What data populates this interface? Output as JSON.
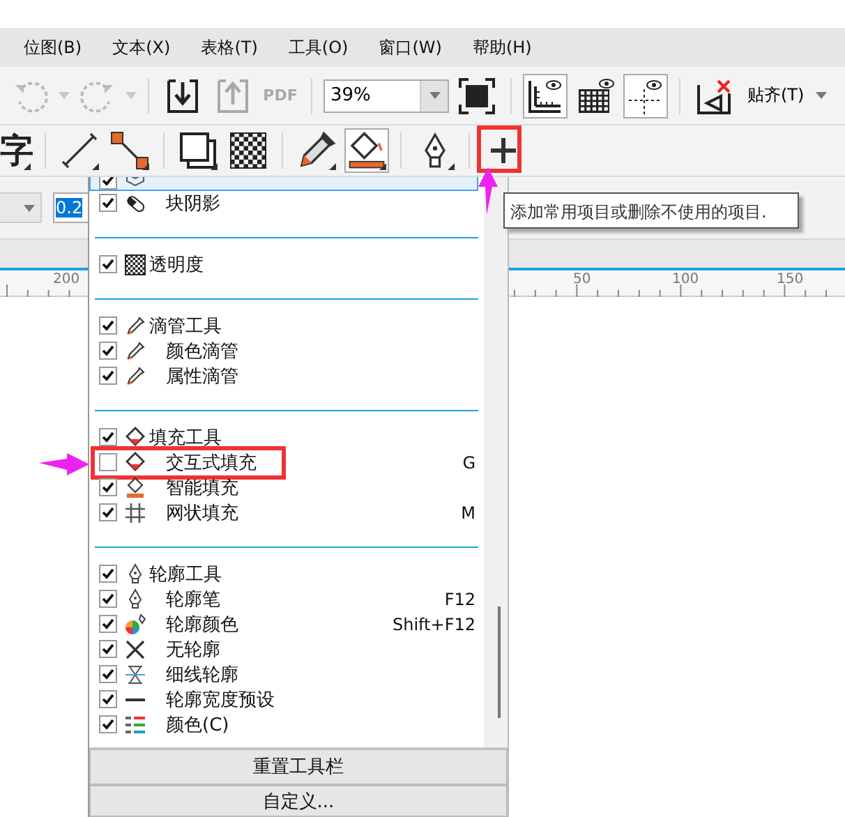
{
  "menu_bar": [
    {
      "label": "位图(B)"
    },
    {
      "label": "文本(X)"
    },
    {
      "label": "表格(T)"
    },
    {
      "label": "工具(O)"
    },
    {
      "label": "窗口(W)"
    },
    {
      "label": "帮助(H)"
    }
  ],
  "standard_toolbar": [
    {
      "kind": "button",
      "disabled": true,
      "dropdown": true
    },
    {
      "kind": "button",
      "disabled": true,
      "dropdown": true
    },
    {
      "kind": "separator"
    },
    {
      "kind": "button",
      "disabled": false
    },
    {
      "kind": "button",
      "disabled": true
    },
    {
      "kind": "button",
      "disabled": true,
      "label": "PDF"
    },
    {
      "kind": "separator"
    },
    {
      "kind": "combo",
      "value": "39%"
    },
    {
      "kind": "button",
      "disabled": false
    },
    {
      "kind": "separator"
    },
    {
      "kind": "button",
      "disabled": false,
      "pressed": true
    },
    {
      "kind": "button",
      "disabled": false,
      "pressed": false
    },
    {
      "kind": "button",
      "disabled": false,
      "pressed": true
    },
    {
      "kind": "separator"
    },
    {
      "kind": "button",
      "disabled": false,
      "pressed": false
    },
    {
      "kind": "dropdown",
      "label": "贴齐(T)"
    }
  ],
  "toolbox": [
    {
      "kind": "text",
      "label": "字",
      "flyout": true
    },
    {
      "kind": "separator"
    },
    {
      "kind": "button",
      "flyout": true,
      "pressed": false
    },
    {
      "kind": "button",
      "flyout": true,
      "pressed": false
    },
    {
      "kind": "separator"
    },
    {
      "kind": "button",
      "flyout": true,
      "pressed": false
    },
    {
      "kind": "button",
      "flyout": false,
      "pressed": false
    },
    {
      "kind": "separator"
    },
    {
      "kind": "button",
      "flyout": true,
      "pressed": false
    },
    {
      "kind": "button",
      "flyout": true,
      "pressed": true
    },
    {
      "kind": "separator"
    },
    {
      "kind": "button",
      "flyout": true,
      "pressed": false
    },
    {
      "kind": "separator"
    },
    {
      "kind": "button",
      "flyout": false,
      "pressed": false,
      "annotated": true
    }
  ],
  "property_bar": {
    "width_field": {
      "value": "0.2",
      "selected": true
    }
  },
  "ruler": {
    "labels": [
      "200",
      "50",
      "100",
      "150"
    ]
  },
  "tooltip": {
    "text": "添加常用项目或删除不使用的项目."
  },
  "customize_menu": {
    "sections": [
      {
        "header": {
          "cut": true,
          "checked": true,
          "highlighted": true,
          "children": [
            {
              "label": "块阴影",
              "checked": true
            }
          ]
        }
      },
      {
        "header": {
          "label": "透明度",
          "checked": true
        }
      },
      {
        "header": {
          "label": "滴管工具",
          "checked": true,
          "children": [
            {
              "label": "颜色滴管",
              "checked": true
            },
            {
              "label": "属性滴管",
              "checked": true
            }
          ]
        }
      },
      {
        "header": {
          "label": "填充工具",
          "checked": true,
          "children": [
            {
              "label": "交互式填充",
              "checked": false,
              "shortcut": "G",
              "annotated": true
            },
            {
              "label": "智能填充",
              "checked": true
            },
            {
              "label": "网状填充",
              "checked": true,
              "shortcut": "M"
            }
          ]
        }
      },
      {
        "header": {
          "label": "轮廓工具",
          "checked": true,
          "children": [
            {
              "label": "轮廓笔",
              "checked": true,
              "shortcut": "F12"
            },
            {
              "label": "轮廓颜色",
              "checked": true,
              "shortcut": "Shift+F12"
            },
            {
              "label": "无轮廓",
              "checked": true
            },
            {
              "label": "细线轮廓",
              "checked": true
            },
            {
              "label": "轮廓宽度预设",
              "checked": true
            },
            {
              "label": "颜色(C)",
              "checked": true
            }
          ]
        }
      }
    ],
    "buttons": [
      {
        "label": "重置工具栏"
      },
      {
        "label": "自定义..."
      }
    ]
  }
}
